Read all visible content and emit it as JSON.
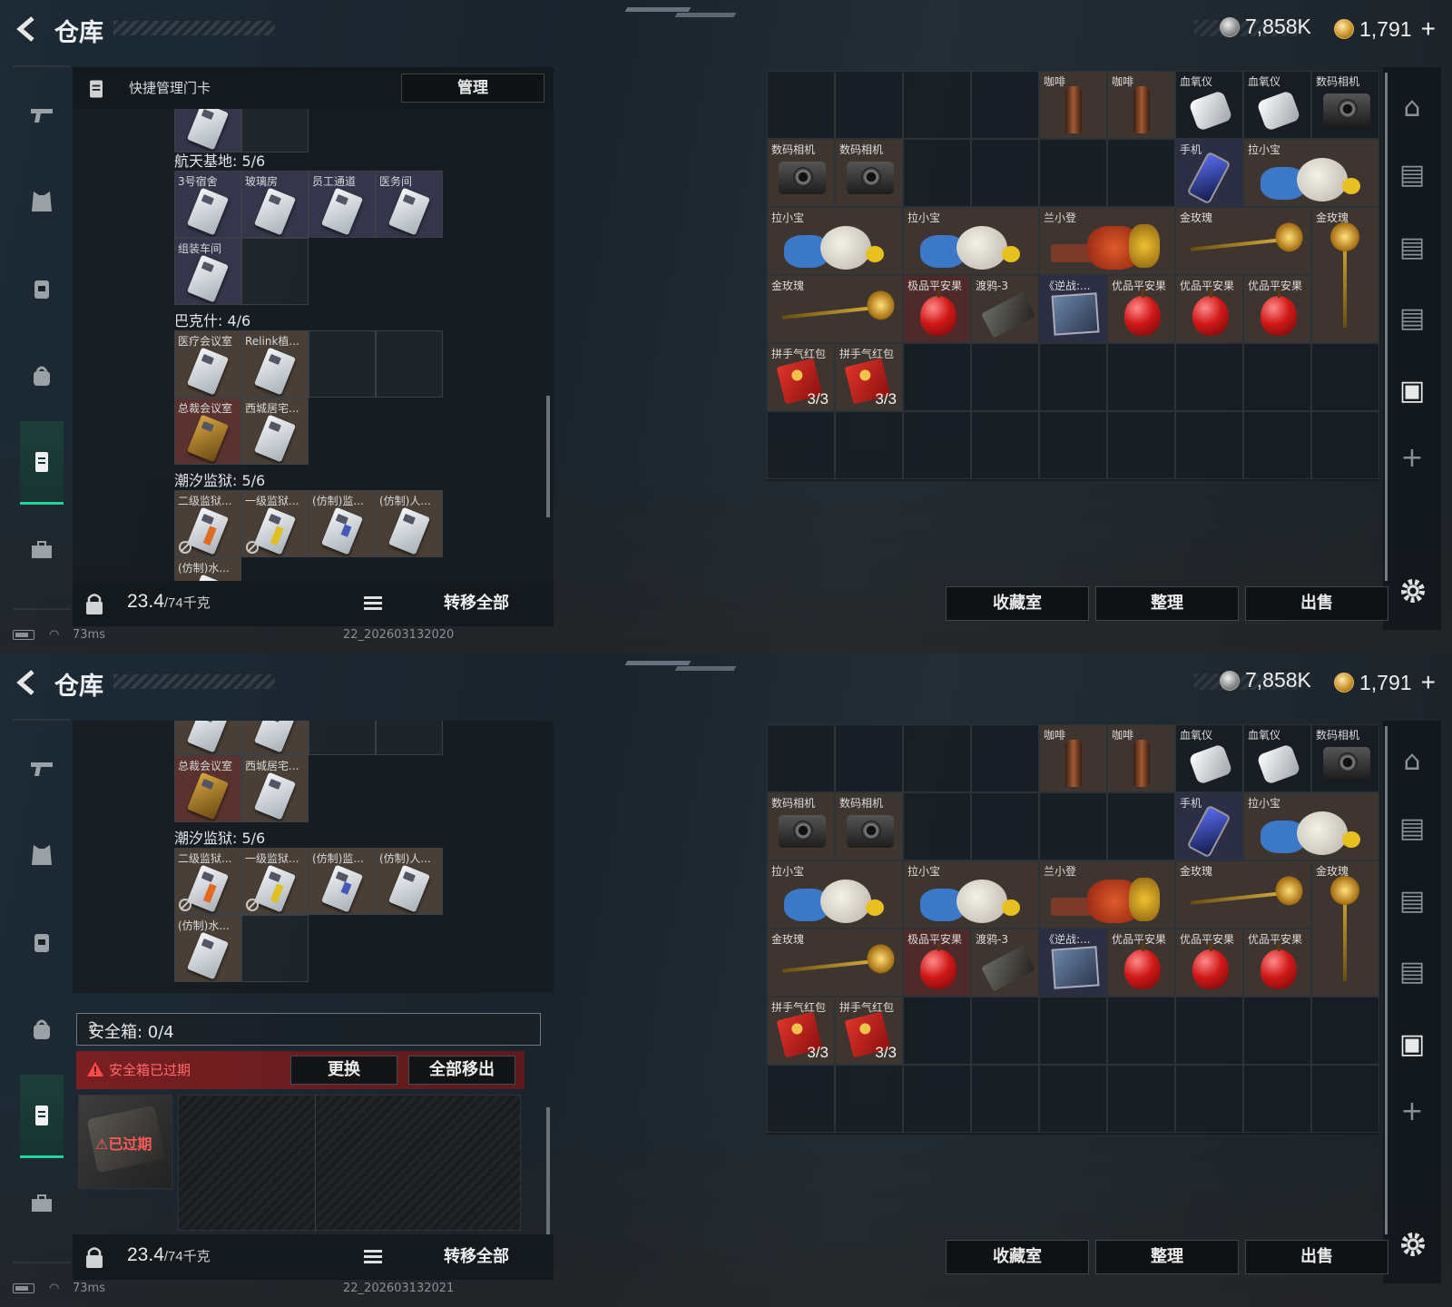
{
  "app": {
    "title": "仓库",
    "currency_silver": "7,858K",
    "currency_gold": "1,791",
    "currency_plus": "+"
  },
  "left_panel": {
    "header_label": "快捷管理门卡",
    "manage_label": "管理",
    "weight_current": "23.4",
    "weight_max": "/74千克",
    "transfer_all_label": "转移全部",
    "sections": {
      "aerospace": {
        "title": "航天基地: 5/6",
        "cards": [
          "3号宿舍",
          "玻璃房",
          "员工通道",
          "医务间",
          "组装车间"
        ]
      },
      "barker": {
        "title": "巴克什: 4/6",
        "cards": [
          "医疗会议室",
          "Relink植...",
          "总裁会议室",
          "西城居宅..."
        ]
      },
      "tide_prison": {
        "title": "潮汐监狱: 5/6",
        "cards": [
          "二级监狱...",
          "一级监狱...",
          "(仿制)监...",
          "(仿制)人...",
          "(仿制)水..."
        ]
      }
    }
  },
  "safe_box": {
    "title": "安全箱: 0/4",
    "help": "?",
    "expired_warning": "安全箱已过期",
    "replace_label": "更换",
    "move_all_label": "全部移出",
    "thumb_label": "已过期"
  },
  "stash_items": {
    "coffee": "咖啡",
    "oximeter": "血氧仪",
    "camera": "数码相机",
    "phone": "手机",
    "doll": "拉小宝",
    "stool": "兰小登",
    "rose": "金玫瑰",
    "apple_premium": "极品平安果",
    "tape": "渡鸦-3",
    "book": "《逆战:...",
    "apple_quality": "优品平安果",
    "red_envelope": "拼手气红包",
    "red_envelope_count": "3/3"
  },
  "right_buttons": {
    "collection": "收藏室",
    "sort": "整理",
    "sell": "出售"
  },
  "status": {
    "ping": "73ms",
    "build_top": "22_202603132020",
    "build_bottom": "22_202603132021"
  },
  "colors": {
    "accent_green": "#26d39b",
    "warning_red": "#ff6b6b",
    "expired_bg": "#7a1f22"
  },
  "icons": [
    "back-icon",
    "silver-coin-icon",
    "gold-coin-icon",
    "pistol-icon",
    "armor-icon",
    "backpack-icon",
    "bag-icon",
    "keycard-holder-icon",
    "toolbox-icon",
    "lock-icon",
    "list-icon",
    "gear-icon",
    "warning-icon",
    "no-sign-icon",
    "vault-icon",
    "storage-icon",
    "plus-icon"
  ]
}
